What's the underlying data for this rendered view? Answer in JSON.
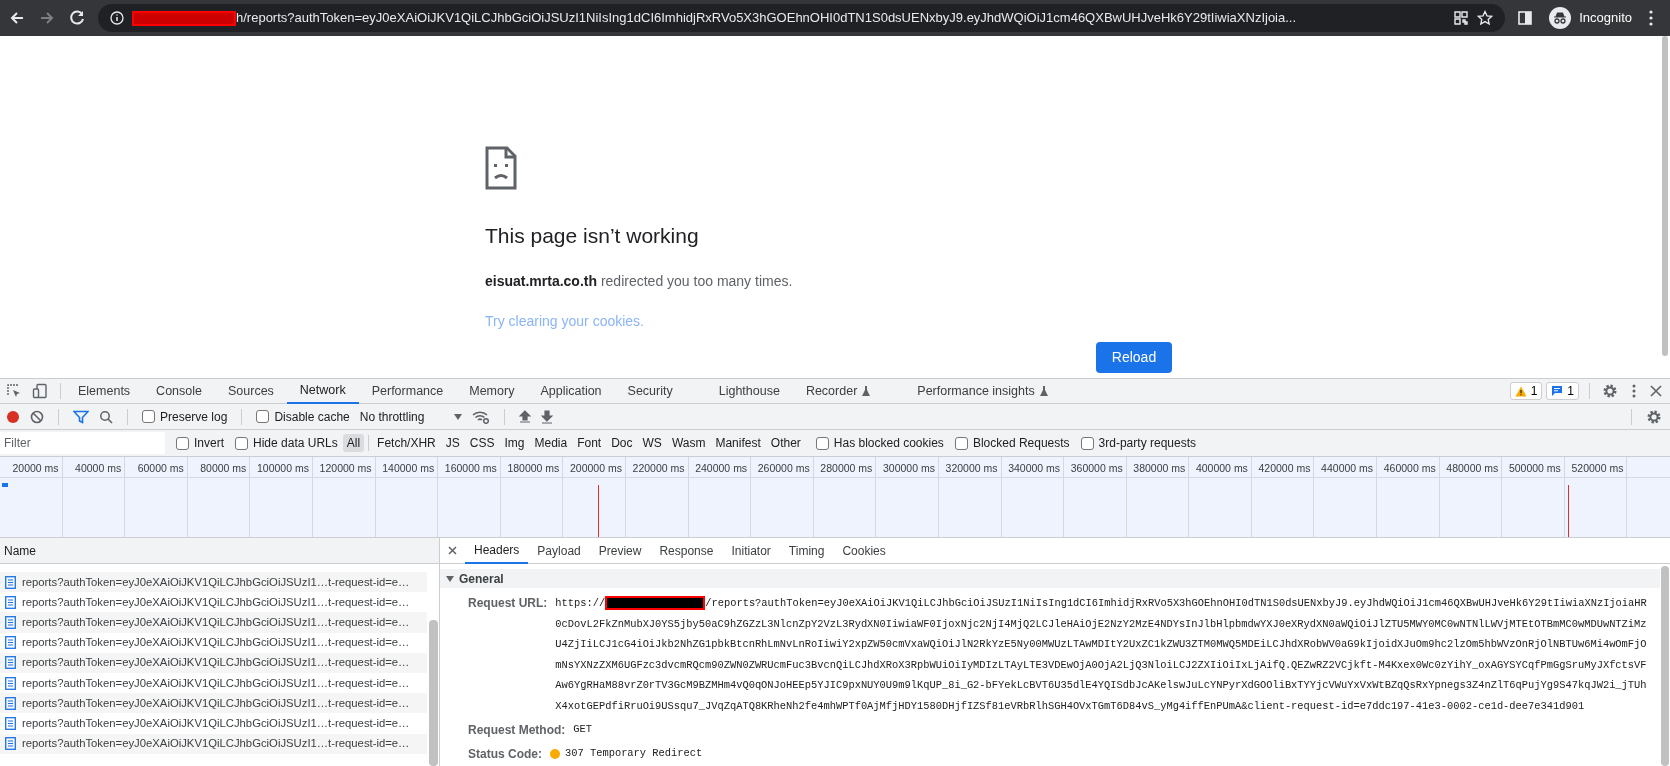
{
  "browser": {
    "url_text": "h/reports?authToken=eyJ0eXAiOiJKV1QiLCJhbGciOiJSUzI1NiIsIng1dCI6ImhidjRxRVo5X3hGOEhnOHI0dTN1S0dsUENxbyJ9.eyJhdWQiOiJ1cm46QXBwUHJveHk6Y29tIiwiaXNzIjoia...",
    "profile_label": "Incognito",
    "forward_disabled": true
  },
  "page": {
    "title": "This page isn’t working",
    "message": "**eisuat.mrta.co.th** redirected you too many times.",
    "link": "Try clearing your cookies.",
    "button": "Reload"
  },
  "devtools": {
    "tabs": [
      {
        "label": "Elements",
        "selected": false,
        "experimental": false
      },
      {
        "label": "Console",
        "selected": false,
        "experimental": false
      },
      {
        "label": "Sources",
        "selected": false,
        "experimental": false
      },
      {
        "label": "Network",
        "selected": true,
        "experimental": false
      },
      {
        "label": "Performance",
        "selected": false,
        "experimental": false
      },
      {
        "label": "Memory",
        "selected": false,
        "experimental": false
      },
      {
        "label": "Application",
        "selected": false,
        "experimental": false
      },
      {
        "label": "Security",
        "selected": false,
        "experimental": false
      },
      {
        "label": "Lighthouse",
        "selected": false,
        "experimental": false
      },
      {
        "label": "Recorder",
        "selected": false,
        "experimental": true
      },
      {
        "label": "Performance insights",
        "selected": false,
        "experimental": true
      }
    ],
    "warnings_count": "1",
    "messages_count": "1",
    "toolbar": {
      "recording": true,
      "preserve_log": {
        "label": "Preserve log",
        "checked": false
      },
      "disable_cache": {
        "label": "Disable cache",
        "checked": false
      },
      "throttling": "No throttling"
    },
    "filter": {
      "placeholder": "Filter",
      "options": [
        {
          "label": "Invert",
          "checked": false
        },
        {
          "label": "Hide data URLs",
          "checked": false
        }
      ],
      "types": [
        {
          "label": "All",
          "selected": true
        },
        {
          "label": "Fetch/XHR",
          "selected": false
        },
        {
          "label": "JS",
          "selected": false
        },
        {
          "label": "CSS",
          "selected": false
        },
        {
          "label": "Img",
          "selected": false
        },
        {
          "label": "Media",
          "selected": false
        },
        {
          "label": "Font",
          "selected": false
        },
        {
          "label": "Doc",
          "selected": false
        },
        {
          "label": "WS",
          "selected": false
        },
        {
          "label": "Wasm",
          "selected": false
        },
        {
          "label": "Manifest",
          "selected": false
        },
        {
          "label": "Other",
          "selected": false
        }
      ],
      "extra_options": [
        {
          "label": "Has blocked cookies",
          "checked": false
        },
        {
          "label": "Blocked Requests",
          "checked": false
        },
        {
          "label": "3rd-party requests",
          "checked": false
        }
      ]
    },
    "timeline_ticks": [
      "20000 ms",
      "40000 ms",
      "60000 ms",
      "80000 ms",
      "100000 ms",
      "120000 ms",
      "140000 ms",
      "160000 ms",
      "180000 ms",
      "200000 ms",
      "220000 ms",
      "240000 ms",
      "260000 ms",
      "280000 ms",
      "300000 ms",
      "320000 ms",
      "340000 ms",
      "360000 ms",
      "380000 ms",
      "400000 ms",
      "420000 ms",
      "440000 ms",
      "460000 ms",
      "480000 ms",
      "500000 ms",
      "520000 ms"
    ],
    "requests": {
      "column": "Name",
      "rows": [
        "reports?authToken=eyJ0eXAiOiJKV1QiLCJhbGciOiJSUzI1…t-request-id=e…",
        "reports?authToken=eyJ0eXAiOiJKV1QiLCJhbGciOiJSUzI1…t-request-id=e…",
        "reports?authToken=eyJ0eXAiOiJKV1QiLCJhbGciOiJSUzI1…t-request-id=e…",
        "reports?authToken=eyJ0eXAiOiJKV1QiLCJhbGciOiJSUzI1…t-request-id=e…",
        "reports?authToken=eyJ0eXAiOiJKV1QiLCJhbGciOiJSUzI1…t-request-id=e…",
        "reports?authToken=eyJ0eXAiOiJKV1QiLCJhbGciOiJSUzI1…t-request-id=e…",
        "reports?authToken=eyJ0eXAiOiJKV1QiLCJhbGciOiJSUzI1…t-request-id=e…",
        "reports?authToken=eyJ0eXAiOiJKV1QiLCJhbGciOiJSUzI1…t-request-id=e…",
        "reports?authToken=eyJ0eXAiOiJKV1QiLCJhbGciOiJSUzI1…t-request-id=e…"
      ]
    },
    "details": {
      "tabs": [
        {
          "label": "Headers",
          "selected": true
        },
        {
          "label": "Payload",
          "selected": false
        },
        {
          "label": "Preview",
          "selected": false
        },
        {
          "label": "Response",
          "selected": false
        },
        {
          "label": "Initiator",
          "selected": false
        },
        {
          "label": "Timing",
          "selected": false
        },
        {
          "label": "Cookies",
          "selected": false
        }
      ],
      "section": {
        "title": "General",
        "expanded": true,
        "request_url": {
          "label": "Request URL:",
          "scheme": "https://",
          "path": "/reports?authToken=eyJ0eXAiOiJKV1QiLCJhbGciOiJSUzI1NiIsIng1dCI6ImhidjRxRVo5X3hGOEhnOHI0dTN1S0dsUENxbyJ9.eyJhdWQiOiJ1cm46QXBwUHJveHk6Y29tIiwiaXNzIjoiaHR0cDovL2FkZnMubXJ0YS5jby50aC9hZGZzL3NlcnZpY2VzL3RydXN0IiwiaWF0IjoxNjc2NjI4MjQ2LCJleHAiOjE2NzY2MzE4NDYsInJlbHlpbmdwYXJ0eXRydXN0aWQiOiJlZTU5MWY0MC0wNTNlLWVjMTEtOTBmMC0wMDUwNTZiMzU4ZjIiLCJ1cG4iOiJkb2NhZG1pbkBtcnRhLmNvLnRoIiwiY2xpZW50cmVxaWQiOiJlN2RkYzE5Ny00MWUzLTAwMDItY2UxZC1kZWU3ZTM0MWQ5MDEiLCJhdXRobWV0aG9kIjoidXJuOm9hc2lzOm5hbWVzOnRjOlNBTUw6Mi4wOmFjOmNsYXNzZXM6UGFzc3dvcmRQcm90ZWN0ZWRUcmFuc3BvcnQiLCJhdXRoX3RpbWUiOiIyMDIzLTAyLTE3VDEwOjA0OjA2LjQ3NloiLCJ2ZXIiOiIxLjAifQ.QEZwRZ2VCjkft-M4Kxex0Wc0zYihY_oxAGYSYCqfPmGgSruMyJXfctsVFAw6YgRHaM88vrZ0rTV3GcM9BZMHm4vQ0qONJoHEEp5YJIC9pxNUY0U9m9lKqUP_8i_G2-bFYekLcBVT6U35dlE4YQISdbJcAKelswJuLcYNPyrXdGOOliBxTYYjcVWuYxVxWtBZqQsRxYpnegs3Z4nZlT6qPujYg9S47kqJW2i_jTUhX4xotGEPdfiRruOi9USsqu7_JVqZqATQ8KRheNh2fe4mhWPTf0AjMfjHDY1580DHjfIZSf81eVRbRlhSGH4OVxTGmT6D84vS_yMg4iffEnPUmA&client-request-id=e7ddc197-41e3-0002-ce1d-dee7e341d901"
        },
        "request_method": {
          "label": "Request Method:",
          "value": "GET"
        },
        "status_code": {
          "label": "Status Code:",
          "value": "307 Temporary Redirect",
          "color": "#f9ab00"
        }
      }
    }
  }
}
